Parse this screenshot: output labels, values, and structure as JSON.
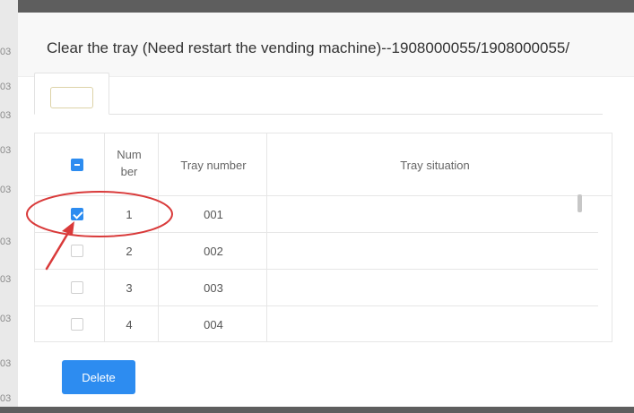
{
  "background": {
    "row_labels": [
      "03",
      "03",
      "03",
      "03",
      "03",
      "03",
      "03",
      "03",
      "03",
      "03",
      "03"
    ]
  },
  "modal": {
    "title": "Clear the tray (Need restart the vending machine)--1908000055/1908000055/"
  },
  "table": {
    "headers": {
      "number": "Num ber",
      "tray_number": "Tray number",
      "tray_situation": "Tray situation"
    },
    "rows": [
      {
        "number": "1",
        "tray_number": "001",
        "tray_situation": "",
        "checked": true
      },
      {
        "number": "2",
        "tray_number": "002",
        "tray_situation": "",
        "checked": false
      },
      {
        "number": "3",
        "tray_number": "003",
        "tray_situation": "",
        "checked": false
      },
      {
        "number": "4",
        "tray_number": "004",
        "tray_situation": "",
        "checked": false
      }
    ]
  },
  "actions": {
    "delete_label": "Delete"
  },
  "colors": {
    "accent": "#2d8cf0",
    "annotation": "#d93a3a"
  },
  "icons": {
    "select_all": "indeterminate-checkbox-icon",
    "annotation": "red-arrow-icon"
  }
}
